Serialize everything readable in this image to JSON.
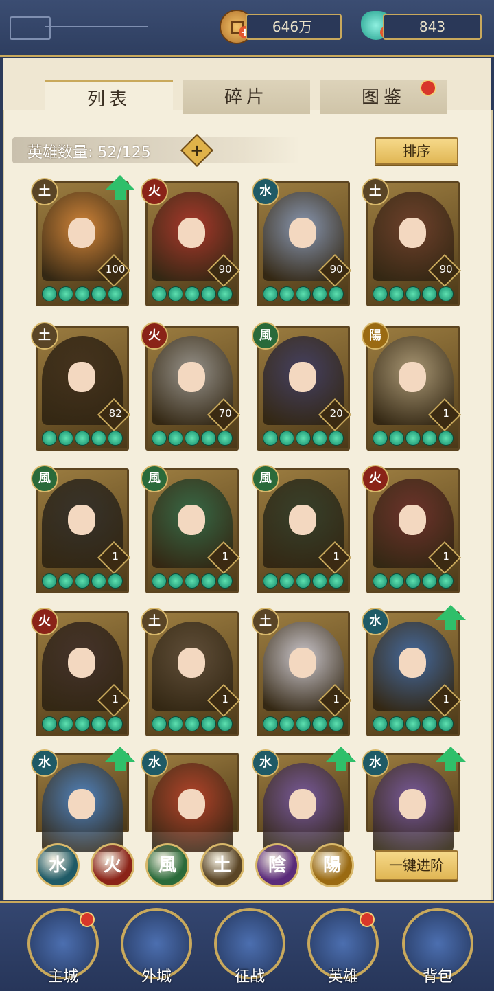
{
  "currency": {
    "coins": "646万",
    "jade": "843"
  },
  "tabs": [
    {
      "label": "列表"
    },
    {
      "label": "碎片"
    },
    {
      "label": "图鉴"
    }
  ],
  "hero_count": {
    "label": "英雄数量: 52/125",
    "add_symbol": "+"
  },
  "sort_button": "排序",
  "quick_advance_button": "一键进阶",
  "elements": [
    {
      "glyph": "水",
      "color": "#1f5a66"
    },
    {
      "glyph": "火",
      "color": "#8a2318"
    },
    {
      "glyph": "風",
      "color": "#2a6a3a"
    },
    {
      "glyph": "土",
      "color": "#5a4526"
    },
    {
      "glyph": "陰",
      "color": "#5a2b7a"
    },
    {
      "glyph": "陽",
      "color": "#9a6a12"
    }
  ],
  "heroes": [
    {
      "element": "土",
      "level": "100",
      "upgrade": true
    },
    {
      "element": "火",
      "level": "90",
      "upgrade": false
    },
    {
      "element": "水",
      "level": "90",
      "upgrade": false
    },
    {
      "element": "土",
      "level": "90",
      "upgrade": false
    },
    {
      "element": "土",
      "level": "82",
      "upgrade": false
    },
    {
      "element": "火",
      "level": "70",
      "upgrade": false
    },
    {
      "element": "風",
      "level": "20",
      "upgrade": false
    },
    {
      "element": "陽",
      "level": "1",
      "upgrade": false
    },
    {
      "element": "風",
      "level": "1",
      "upgrade": false
    },
    {
      "element": "風",
      "level": "1",
      "upgrade": false
    },
    {
      "element": "風",
      "level": "1",
      "upgrade": false
    },
    {
      "element": "火",
      "level": "1",
      "upgrade": false
    },
    {
      "element": "火",
      "level": "1",
      "upgrade": false
    },
    {
      "element": "土",
      "level": "1",
      "upgrade": false
    },
    {
      "element": "土",
      "level": "1",
      "upgrade": false
    },
    {
      "element": "水",
      "level": "1",
      "upgrade": true
    },
    {
      "element": "水",
      "level": "",
      "upgrade": true
    },
    {
      "element": "水",
      "level": "",
      "upgrade": false
    },
    {
      "element": "水",
      "level": "",
      "upgrade": true
    },
    {
      "element": "水",
      "level": "",
      "upgrade": true
    }
  ],
  "nav": [
    {
      "label": "主城",
      "badge": true
    },
    {
      "label": "外城",
      "badge": false
    },
    {
      "label": "征战",
      "badge": false
    },
    {
      "label": "英雄",
      "badge": true
    },
    {
      "label": "背包",
      "badge": false
    }
  ]
}
